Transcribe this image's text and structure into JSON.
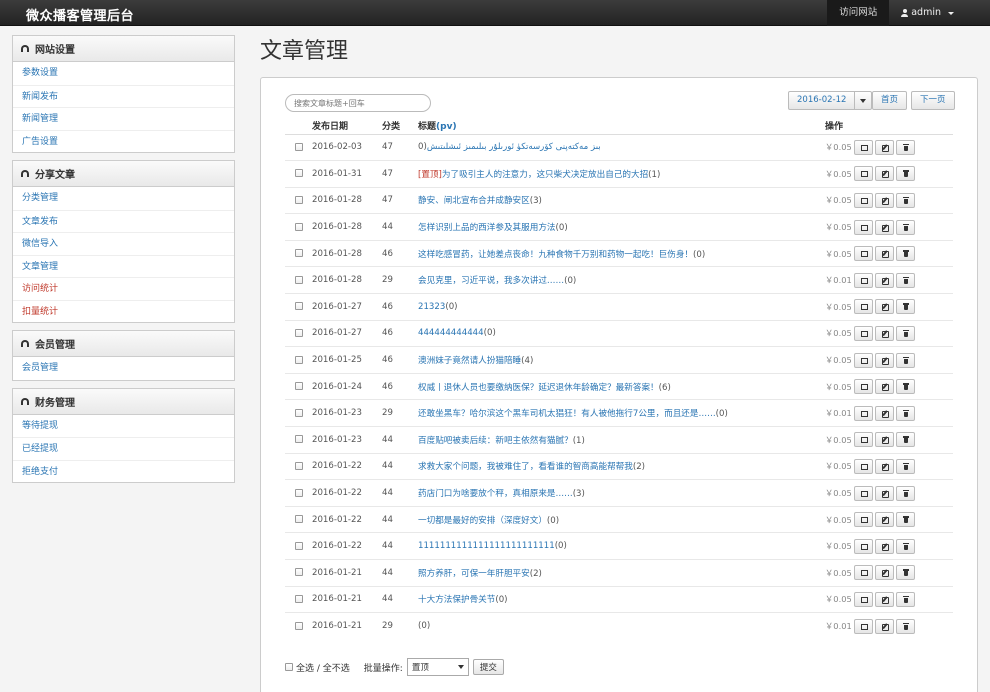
{
  "navbar": {
    "brand": "微众播客管理后台",
    "visit_label": "访问网站",
    "user_label": "admin"
  },
  "sidebar": {
    "panels": [
      {
        "title": "网站设置",
        "items": [
          {
            "label": "参数设置"
          },
          {
            "label": "新闻发布"
          },
          {
            "label": "新闻管理"
          },
          {
            "label": "广告设置"
          }
        ]
      },
      {
        "title": "分享文章",
        "items": [
          {
            "label": "分类管理"
          },
          {
            "label": "文章发布"
          },
          {
            "label": "微信导入"
          },
          {
            "label": "文章管理"
          },
          {
            "label": "访问统计"
          },
          {
            "label": "扣量统计"
          }
        ]
      },
      {
        "title": "会员管理",
        "items": [
          {
            "label": "会员管理"
          }
        ]
      },
      {
        "title": "财务管理",
        "items": [
          {
            "label": "等待提现"
          },
          {
            "label": "已经提现"
          },
          {
            "label": "拒绝支付"
          }
        ]
      }
    ]
  },
  "main": {
    "page_title": "文章管理",
    "search_placeholder": "搜索文章标题+回车",
    "date_value": "2016-02-12",
    "home_label": "首页",
    "next_label": "下一页",
    "columns": {
      "date": "发布日期",
      "category": "分类",
      "title": "标题",
      "title_suffix": "(pv)",
      "ops": "操作"
    },
    "rows": [
      {
        "date": "2016-02-03",
        "cat": "47",
        "pin": "",
        "title": "بىز مەكتەپنى كۆرسەتكۈ ئورىلۇر بىلىمىز ئىشلىتىش",
        "count": "(0",
        "price": "￥0.05"
      },
      {
        "date": "2016-01-31",
        "cat": "47",
        "pin": "[置顶]",
        "title": "为了吸引主人的注意力，这只柴犬决定放出自己的大招",
        "count": "(1)",
        "price": "￥0.05"
      },
      {
        "date": "2016-01-28",
        "cat": "47",
        "pin": "",
        "title": "静安、闸北宣布合并成静安区",
        "count": "(3)",
        "price": "￥0.05"
      },
      {
        "date": "2016-01-28",
        "cat": "44",
        "pin": "",
        "title": "怎样识别上品的西洋参及其服用方法",
        "count": "(0)",
        "price": "￥0.05"
      },
      {
        "date": "2016-01-28",
        "cat": "46",
        "pin": "",
        "title": "这样吃感冒药，让她差点丧命！九种食物千万别和药物一起吃！巨伤身！",
        "count": "(0)",
        "price": "￥0.05"
      },
      {
        "date": "2016-01-28",
        "cat": "29",
        "pin": "",
        "title": "会见克里，习近平说，我多次讲过……",
        "count": "(0)",
        "price": "￥0.01"
      },
      {
        "date": "2016-01-27",
        "cat": "46",
        "pin": "",
        "title": "21323",
        "count": "(0)",
        "price": "￥0.05"
      },
      {
        "date": "2016-01-27",
        "cat": "46",
        "pin": "",
        "title": "444444444444",
        "count": "(0)",
        "price": "￥0.05"
      },
      {
        "date": "2016-01-25",
        "cat": "46",
        "pin": "",
        "title": "澳洲妹子竟然请人扮猫陪睡",
        "count": "(4)",
        "price": "￥0.05"
      },
      {
        "date": "2016-01-24",
        "cat": "46",
        "pin": "",
        "title": "权威丨退休人员也要缴纳医保？延迟退休年龄确定？最新答案！",
        "count": "(6)",
        "price": "￥0.05"
      },
      {
        "date": "2016-01-23",
        "cat": "29",
        "pin": "",
        "title": "还敢坐黑车？哈尔滨这个黑车司机太猖狂！有人被他拖行7公里，而且还是……",
        "count": "(0)",
        "price": "￥0.01"
      },
      {
        "date": "2016-01-23",
        "cat": "44",
        "pin": "",
        "title": "百度贴吧被卖后续：新吧主依然有猫腻？",
        "count": "(1)",
        "price": "￥0.05"
      },
      {
        "date": "2016-01-22",
        "cat": "44",
        "pin": "",
        "title": "求救大家个问题，我被难住了，看看谁的智商高能帮帮我",
        "count": "(2)",
        "price": "￥0.05"
      },
      {
        "date": "2016-01-22",
        "cat": "44",
        "pin": "",
        "title": "药店门口为啥要放个秤，真相原来是……",
        "count": "(3)",
        "price": "￥0.05"
      },
      {
        "date": "2016-01-22",
        "cat": "44",
        "pin": "",
        "title": "一切都是最好的安排（深度好文）",
        "count": "(0)",
        "price": "￥0.05"
      },
      {
        "date": "2016-01-22",
        "cat": "44",
        "pin": "",
        "title": "1111111111111111111111111",
        "count": "(0)",
        "price": "￥0.05"
      },
      {
        "date": "2016-01-21",
        "cat": "44",
        "pin": "",
        "title": "照方养肝，可保一年肝胆平安",
        "count": "(2)",
        "price": "￥0.05"
      },
      {
        "date": "2016-01-21",
        "cat": "44",
        "pin": "",
        "title": "十大方法保护骨关节",
        "count": "(0)",
        "price": "￥0.05"
      },
      {
        "date": "2016-01-21",
        "cat": "29",
        "pin": "",
        "title": "",
        "count": "(0)",
        "price": "￥0.01"
      }
    ],
    "footer": {
      "select_all_label": "全选 / 全不选",
      "batch_label": "批量操作:",
      "batch_value": "置顶",
      "submit_label": "提交"
    }
  }
}
